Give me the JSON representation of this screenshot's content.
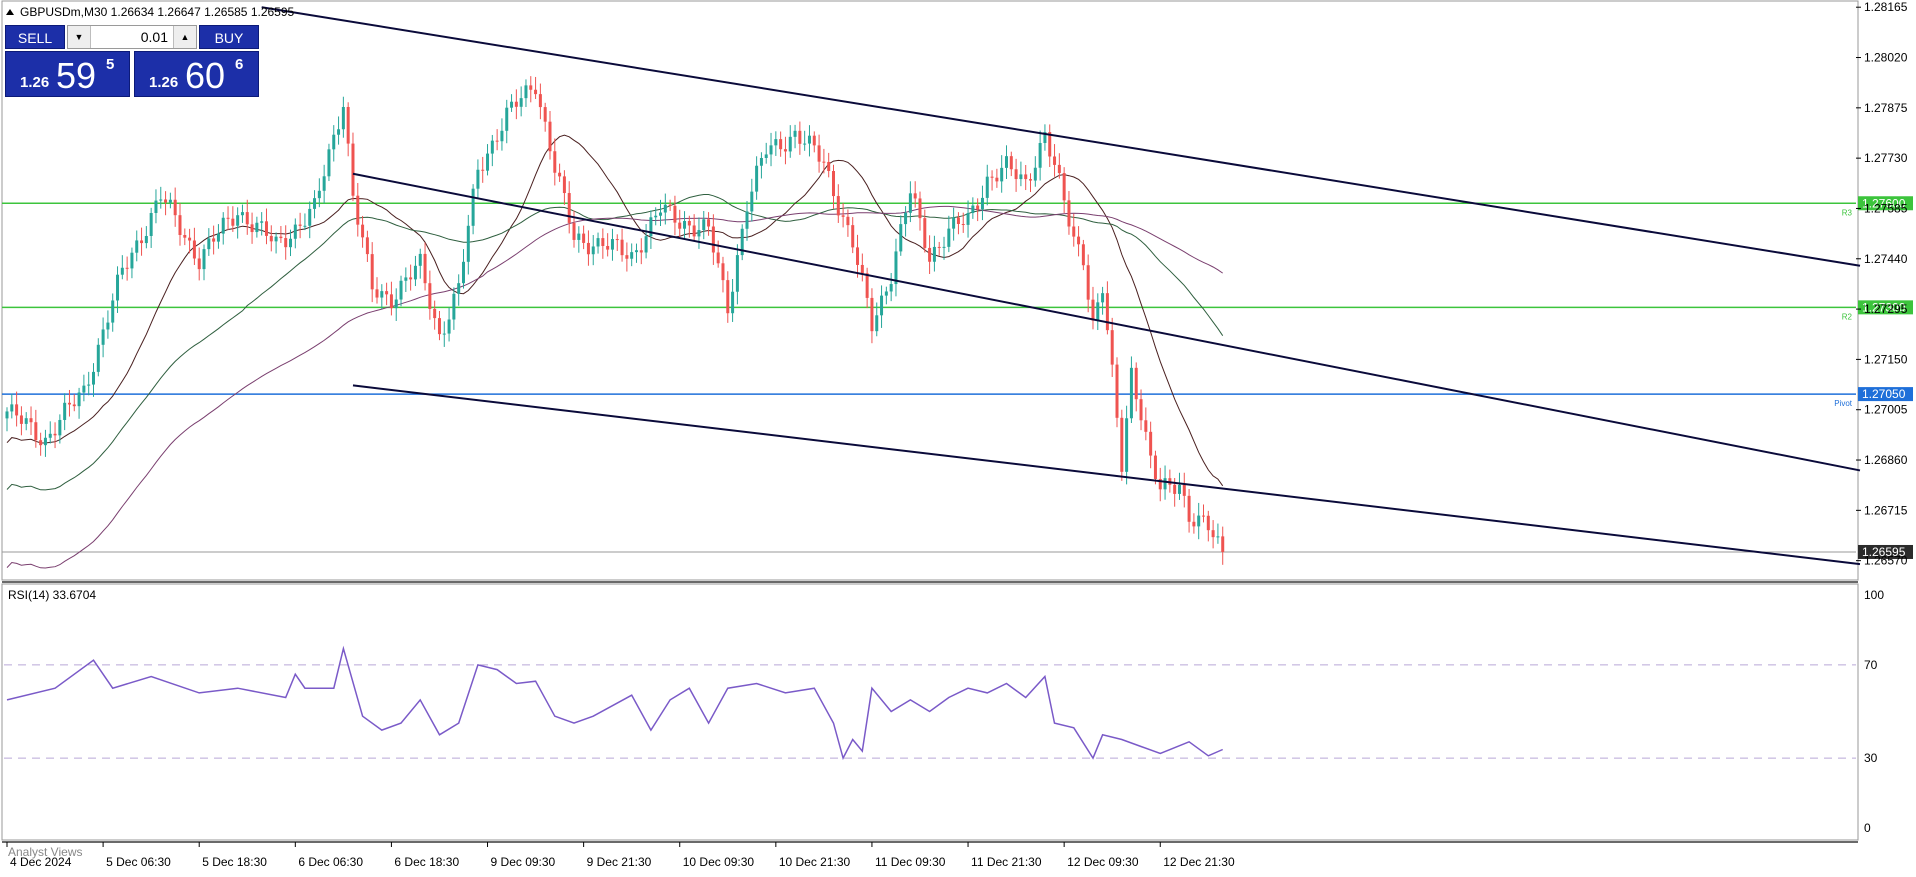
{
  "header": {
    "symbol_info": "GBPUSDm,M30  1.26634 1.26647 1.26585 1.26595",
    "indicator_label": "RSI(14) 33.6704",
    "bottom_label": "Analyst Views"
  },
  "trade_panel": {
    "sell_label": "SELL",
    "buy_label": "BUY",
    "lot": "0.01",
    "sell_small": "1.26",
    "sell_big": "59",
    "sell_sup": "5",
    "buy_small": "1.26",
    "buy_big": "60",
    "buy_sup": "6"
  },
  "colors": {
    "bull": "#26a69a",
    "bear": "#ef5350",
    "support_resistance": "#3cc43c",
    "pivot": "#1e6fd9",
    "channel": "#0a0a3a",
    "rsi": "#7a5ac8",
    "ma_fast": "#4a2020",
    "ma_mid": "#2f5f3f",
    "ma_slow": "#7a3f6f"
  },
  "chart_data": [
    {
      "type": "candlestick",
      "title": "GBPUSDm,M30",
      "ylim": [
        1.2652,
        1.2818
      ],
      "y_ticks": [
        "1.28165",
        "1.28020",
        "1.27875",
        "1.27730",
        "1.27585",
        "1.27440",
        "1.27295",
        "1.27150",
        "1.27005",
        "1.26860",
        "1.26715",
        "1.26570"
      ],
      "x_labels": [
        "4 Dec 2024",
        "5 Dec 06:30",
        "5 Dec 18:30",
        "6 Dec 06:30",
        "6 Dec 18:30",
        "9 Dec 09:30",
        "9 Dec 21:30",
        "10 Dec 09:30",
        "10 Dec 21:30",
        "11 Dec 09:30",
        "11 Dec 21:30",
        "12 Dec 09:30",
        "12 Dec 21:30"
      ],
      "x_label_bar_index": [
        0,
        20,
        40,
        60,
        80,
        100,
        120,
        140,
        160,
        180,
        200,
        220,
        240
      ],
      "bar_count": 254,
      "close_anchors": [
        [
          0,
          1.27
        ],
        [
          8,
          1.2692
        ],
        [
          16,
          1.2706
        ],
        [
          24,
          1.274
        ],
        [
          32,
          1.2762
        ],
        [
          40,
          1.2744
        ],
        [
          48,
          1.2758
        ],
        [
          56,
          1.2748
        ],
        [
          64,
          1.2758
        ],
        [
          70,
          1.279
        ],
        [
          72,
          1.2762
        ],
        [
          76,
          1.2735
        ],
        [
          80,
          1.2733
        ],
        [
          86,
          1.2742
        ],
        [
          90,
          1.2722
        ],
        [
          94,
          1.2735
        ],
        [
          98,
          1.277
        ],
        [
          104,
          1.2785
        ],
        [
          110,
          1.2795
        ],
        [
          114,
          1.277
        ],
        [
          118,
          1.275
        ],
        [
          124,
          1.2748
        ],
        [
          130,
          1.2745
        ],
        [
          136,
          1.2758
        ],
        [
          140,
          1.2755
        ],
        [
          146,
          1.2752
        ],
        [
          150,
          1.273
        ],
        [
          154,
          1.276
        ],
        [
          158,
          1.2775
        ],
        [
          164,
          1.278
        ],
        [
          170,
          1.2772
        ],
        [
          176,
          1.2748
        ],
        [
          180,
          1.2725
        ],
        [
          184,
          1.274
        ],
        [
          188,
          1.2763
        ],
        [
          192,
          1.2745
        ],
        [
          196,
          1.2752
        ],
        [
          200,
          1.2755
        ],
        [
          204,
          1.2767
        ],
        [
          208,
          1.277
        ],
        [
          212,
          1.2766
        ],
        [
          216,
          1.278
        ],
        [
          220,
          1.276
        ],
        [
          222,
          1.275
        ],
        [
          224,
          1.2745
        ],
        [
          226,
          1.2725
        ],
        [
          228,
          1.2735
        ],
        [
          230,
          1.271
        ],
        [
          232,
          1.2685
        ],
        [
          234,
          1.2712
        ],
        [
          236,
          1.27
        ],
        [
          238,
          1.2685
        ],
        [
          240,
          1.2677
        ],
        [
          244,
          1.268
        ],
        [
          246,
          1.267
        ],
        [
          250,
          1.2666
        ],
        [
          253,
          1.26595
        ]
      ],
      "levels": [
        {
          "value": 1.276,
          "label": "1.27600",
          "tag": "R3",
          "kind": "resistance"
        },
        {
          "value": 1.273,
          "label": "1.27300",
          "tag": "R2",
          "kind": "resistance"
        },
        {
          "value": 1.2705,
          "label": "1.27050",
          "tag": "Pivot",
          "kind": "pivot"
        },
        {
          "value": 1.26595,
          "label": "1.26595",
          "tag": "",
          "kind": "bid"
        }
      ],
      "channels": [
        {
          "from": [
            53,
            1.28165
          ],
          "to": [
            253,
            1.2742
          ]
        },
        {
          "from": [
            72,
            1.27685
          ],
          "to": [
            253,
            1.2683
          ]
        },
        {
          "from": [
            72,
            1.27075
          ],
          "to": [
            253,
            1.2656
          ]
        }
      ],
      "moving_averages": [
        {
          "period": 20,
          "color_key": "ma_fast"
        },
        {
          "period": 50,
          "color_key": "ma_mid"
        },
        {
          "period": 100,
          "color_key": "ma_slow"
        }
      ]
    },
    {
      "type": "line",
      "title": "RSI(14)",
      "series": [
        {
          "name": "RSI(14)",
          "last": 33.6704
        }
      ],
      "ylim": [
        0,
        100
      ],
      "y_ticks": [
        "100",
        "70",
        "30",
        "0"
      ],
      "levels": [
        70,
        30
      ],
      "points": [
        [
          0,
          55
        ],
        [
          10,
          60
        ],
        [
          18,
          72
        ],
        [
          22,
          60
        ],
        [
          30,
          65
        ],
        [
          40,
          58
        ],
        [
          48,
          60
        ],
        [
          58,
          56
        ],
        [
          60,
          66
        ],
        [
          62,
          60
        ],
        [
          68,
          60
        ],
        [
          70,
          77
        ],
        [
          74,
          48
        ],
        [
          78,
          42
        ],
        [
          82,
          45
        ],
        [
          86,
          55
        ],
        [
          90,
          40
        ],
        [
          94,
          45
        ],
        [
          98,
          70
        ],
        [
          102,
          68
        ],
        [
          106,
          62
        ],
        [
          110,
          63
        ],
        [
          114,
          48
        ],
        [
          118,
          45
        ],
        [
          122,
          48
        ],
        [
          130,
          57
        ],
        [
          134,
          42
        ],
        [
          138,
          55
        ],
        [
          142,
          60
        ],
        [
          146,
          45
        ],
        [
          150,
          60
        ],
        [
          156,
          62
        ],
        [
          162,
          58
        ],
        [
          168,
          60
        ],
        [
          172,
          45
        ],
        [
          174,
          30
        ],
        [
          176,
          38
        ],
        [
          178,
          33
        ],
        [
          180,
          60
        ],
        [
          184,
          50
        ],
        [
          188,
          55
        ],
        [
          192,
          50
        ],
        [
          196,
          56
        ],
        [
          200,
          60
        ],
        [
          204,
          58
        ],
        [
          208,
          62
        ],
        [
          212,
          56
        ],
        [
          216,
          65
        ],
        [
          218,
          45
        ],
        [
          222,
          43
        ],
        [
          226,
          30
        ],
        [
          228,
          40
        ],
        [
          232,
          38
        ],
        [
          236,
          35
        ],
        [
          240,
          32
        ],
        [
          246,
          37
        ],
        [
          250,
          31
        ],
        [
          253,
          33.6704
        ]
      ]
    }
  ]
}
